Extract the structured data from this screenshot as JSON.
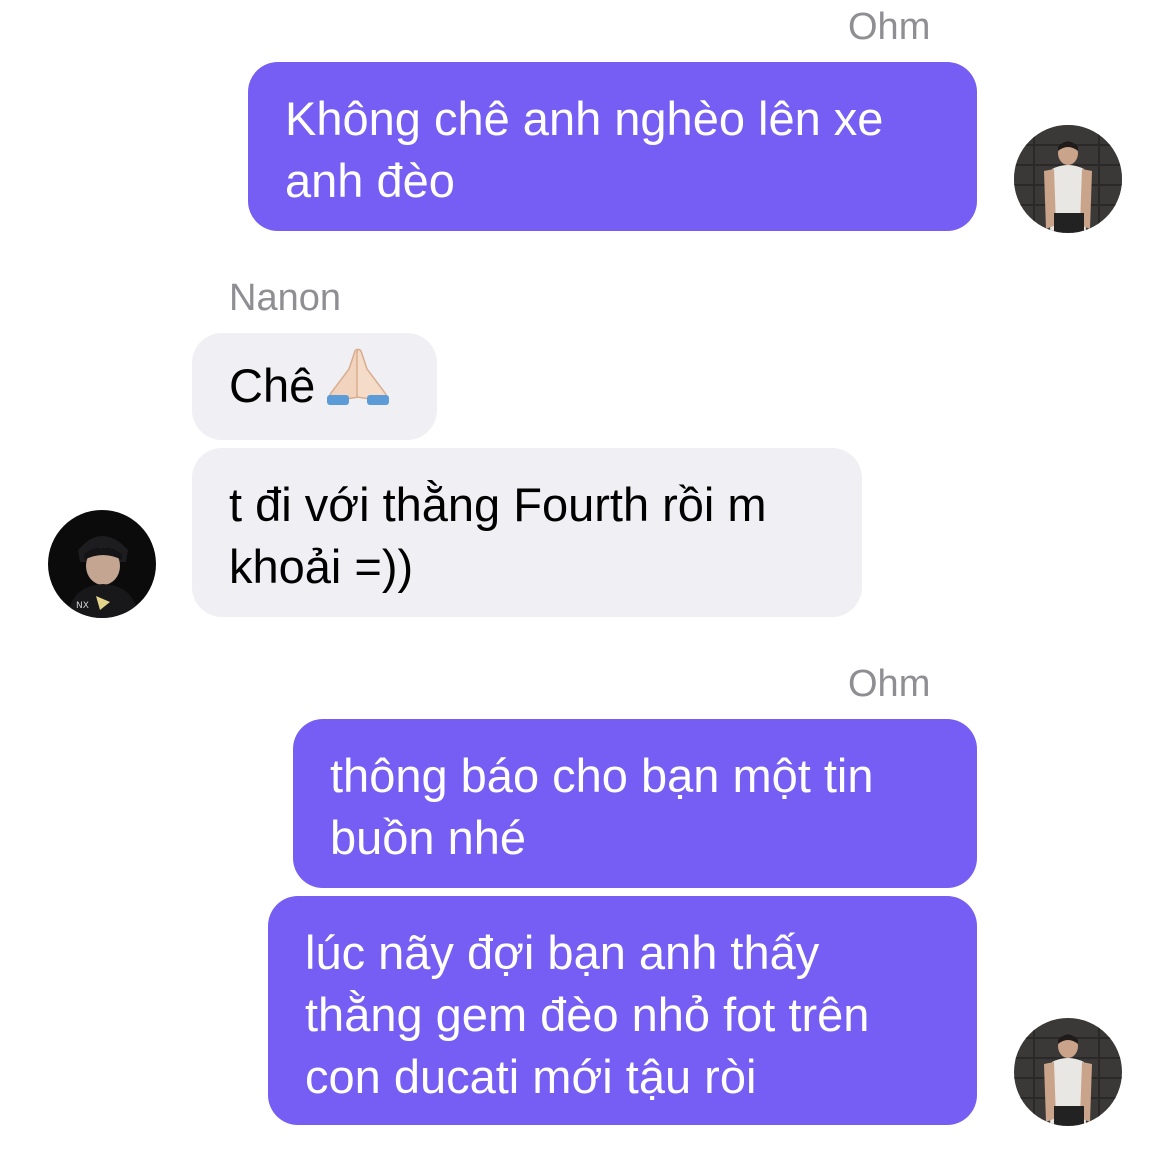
{
  "conversation": {
    "groups": [
      {
        "sender": "Ohm",
        "direction": "outgoing",
        "messages": [
          "Không chê anh nghèo lên xe anh đèo"
        ]
      },
      {
        "sender": "Nanon",
        "direction": "incoming",
        "messages": [
          "Chê",
          "t đi với thằng Fourth rồi m khoải =))"
        ],
        "emoji": "folded-hands-icon"
      },
      {
        "sender": "Ohm",
        "direction": "outgoing",
        "messages": [
          "thông báo cho bạn một tin buồn nhé",
          "lúc nãy đợi bạn anh thấy thằng gem đèo nhỏ fot trên con ducati mới tậu ròi"
        ]
      }
    ]
  },
  "colors": {
    "outgoing_bubble": "#765df3",
    "incoming_bubble": "#efeff4",
    "sender_name": "#8e8e93"
  },
  "icons": {
    "ohm_avatar": "avatar-ohm",
    "nanon_avatar": "avatar-nanon",
    "emoji": "folded-hands-icon"
  }
}
